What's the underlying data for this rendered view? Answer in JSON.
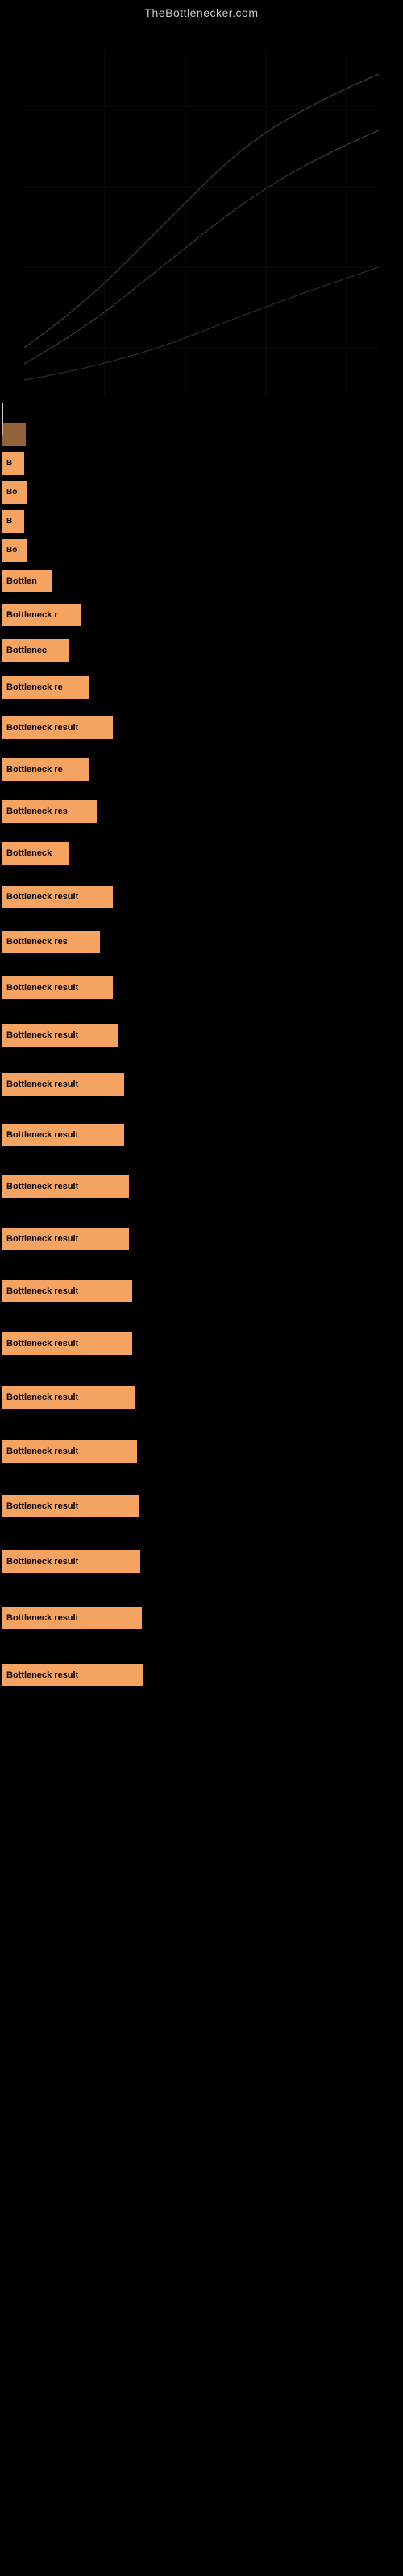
{
  "site": {
    "title": "TheBottlenecker.com"
  },
  "results": [
    {
      "id": 1,
      "label": "",
      "width_class": "w-30",
      "visible": false
    },
    {
      "id": 2,
      "label": "B",
      "width_class": "w-30",
      "visible": true
    },
    {
      "id": 3,
      "label": "Bo",
      "width_class": "w-35",
      "visible": true
    },
    {
      "id": 4,
      "label": "B",
      "width_class": "w-30",
      "visible": true
    },
    {
      "id": 5,
      "label": "Bo",
      "width_class": "w-35",
      "visible": true
    },
    {
      "id": 6,
      "label": "Bottlen",
      "width_class": "w-65",
      "visible": true
    },
    {
      "id": 7,
      "label": "Bottleneck r",
      "width_class": "w-100",
      "visible": true
    },
    {
      "id": 8,
      "label": "Bottlenec",
      "width_class": "w-85",
      "visible": true
    },
    {
      "id": 9,
      "label": "Bottleneck re",
      "width_class": "w-110",
      "visible": true
    },
    {
      "id": 10,
      "label": "Bottleneck result",
      "width_class": "w-140",
      "visible": true
    },
    {
      "id": 11,
      "label": "Bottleneck re",
      "width_class": "w-110",
      "visible": true
    },
    {
      "id": 12,
      "label": "Bottleneck res",
      "width_class": "w-120",
      "visible": true
    },
    {
      "id": 13,
      "label": "Bottleneck",
      "width_class": "w-85",
      "visible": true
    },
    {
      "id": 14,
      "label": "Bottleneck result",
      "width_class": "w-140",
      "visible": true
    },
    {
      "id": 15,
      "label": "Bottleneck res",
      "width_class": "w-120",
      "visible": true
    },
    {
      "id": 16,
      "label": "Bottleneck result",
      "width_class": "w-140",
      "visible": true
    },
    {
      "id": 17,
      "label": "Bottleneck result",
      "width_class": "w-145",
      "visible": true
    },
    {
      "id": 18,
      "label": "Bottleneck result",
      "width_class": "w-150",
      "visible": true
    },
    {
      "id": 19,
      "label": "Bottleneck result",
      "width_class": "w-150",
      "visible": true
    },
    {
      "id": 20,
      "label": "Bottleneck result",
      "width_class": "w-155",
      "visible": true
    },
    {
      "id": 21,
      "label": "Bottleneck result",
      "width_class": "w-155",
      "visible": true
    },
    {
      "id": 22,
      "label": "Bottleneck result",
      "width_class": "w-160",
      "visible": true
    },
    {
      "id": 23,
      "label": "Bottleneck result",
      "width_class": "w-160",
      "visible": true
    },
    {
      "id": 24,
      "label": "Bottleneck result",
      "width_class": "w-165",
      "visible": true
    },
    {
      "id": 25,
      "label": "Bottleneck result",
      "width_class": "w-165",
      "visible": true
    },
    {
      "id": 26,
      "label": "Bottleneck result",
      "width_class": "w-170",
      "visible": true
    },
    {
      "id": 27,
      "label": "Bottleneck result",
      "width_class": "w-170",
      "visible": true
    },
    {
      "id": 28,
      "label": "Bottleneck result",
      "width_class": "w-175",
      "visible": true
    },
    {
      "id": 29,
      "label": "Bottleneck result",
      "width_class": "w-175",
      "visible": true
    }
  ],
  "colors": {
    "background": "#000000",
    "label_bg": "#f4a460",
    "label_text": "#000000",
    "site_title": "#cccccc"
  }
}
